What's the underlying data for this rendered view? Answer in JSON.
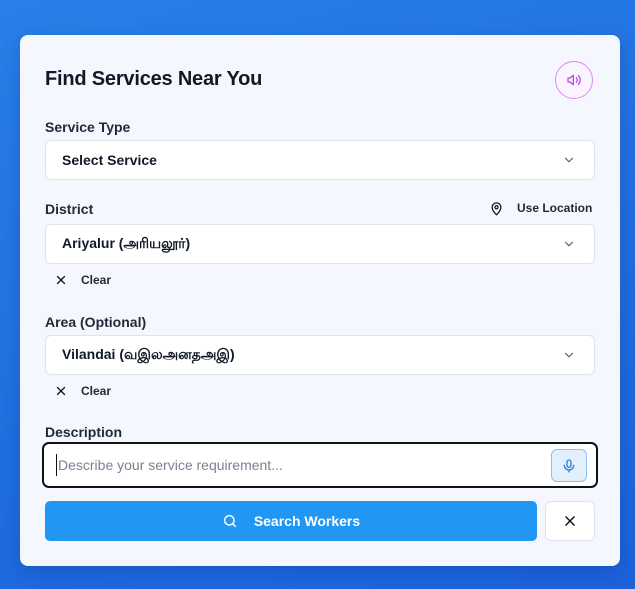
{
  "form": {
    "title": "Find Services Near You",
    "speaker_icon": "speaker-icon",
    "service_type": {
      "label": "Service Type",
      "selected": "Select Service"
    },
    "district": {
      "label": "District",
      "use_location_label": "Use Location",
      "selected": "Ariyalur (அரியலூர்)",
      "clear_label": "Clear"
    },
    "area": {
      "label": "Area (Optional)",
      "selected": "Vilandai (வஇலஅனதஅஇ)",
      "clear_label": "Clear"
    },
    "description": {
      "label": "Description",
      "value": "",
      "placeholder": "Describe your service requirement..."
    },
    "search_button_label": "Search Workers"
  },
  "colors": {
    "background": "#1f6fe0",
    "card": "#f4f7fd",
    "primary": "#2196f3",
    "speaker_accent": "#b44fe0",
    "mic_accent": "#2f7fd8"
  }
}
